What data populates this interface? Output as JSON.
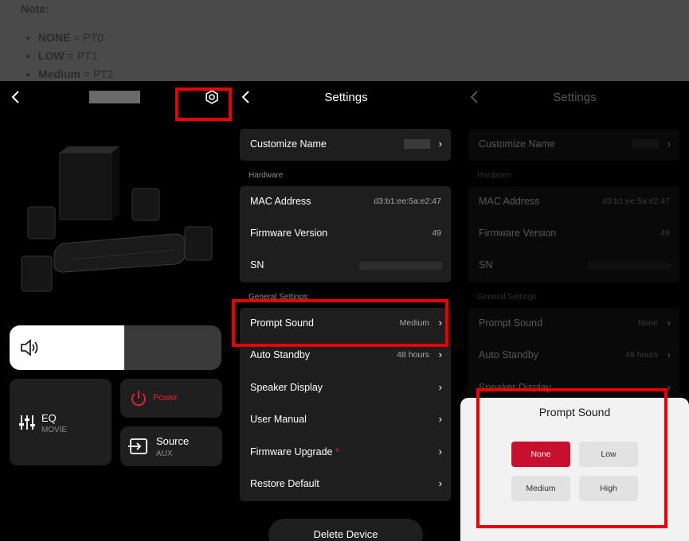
{
  "note": {
    "title": "Note:",
    "items": [
      {
        "key": "NONE",
        "value": " = PT0"
      },
      {
        "key": "LOW",
        "value": " = PT1"
      },
      {
        "key": "Medium",
        "value": " = PT2"
      }
    ]
  },
  "device": {
    "volume_level": 0.54,
    "eq_label": "EQ",
    "eq_value": "MOVIE",
    "power_label": "Power",
    "source_label": "Source",
    "source_value": "AUX",
    "accent_color": "#c8102e"
  },
  "settings": {
    "title": "Settings",
    "customize_name_label": "Customize Name",
    "hardware_header": "Hardware",
    "mac_label": "MAC Address",
    "mac_value": "d3:b1:ee:5a:e2:47",
    "firmware_label": "Firmware Version",
    "firmware_value": "49",
    "sn_label": "SN",
    "general_header": "General Settings",
    "prompt_label": "Prompt Sound",
    "prompt_value": "Medium",
    "standby_label": "Auto Standby",
    "standby_value": "48 hours",
    "speaker_display_label": "Speaker Display",
    "user_manual_label": "User Manual",
    "firmware_upgrade_label": "Firmware Upgrade",
    "firmware_upgrade_badge": "*",
    "restore_label": "Restore Default",
    "delete_label": "Delete Device",
    "chevron": "›"
  },
  "settings_right": {
    "title": "Settings",
    "customize_name_label": "Customize Name",
    "hardware_header": "Hardware",
    "mac_label": "MAC Address",
    "mac_value": "d3:b1:ee:5a:e2:47",
    "firmware_label": "Firmware Version",
    "firmware_value": "49",
    "sn_label": "SN",
    "general_header": "General Settings",
    "prompt_label": "Prompt Sound",
    "prompt_value": "None",
    "standby_label": "Auto Standby",
    "standby_value": "48 hours",
    "speaker_display_label": "Speaker Display"
  },
  "prompt_modal": {
    "title": "Prompt Sound",
    "options": [
      "None",
      "Low",
      "Medium",
      "High"
    ],
    "selected": "None"
  }
}
